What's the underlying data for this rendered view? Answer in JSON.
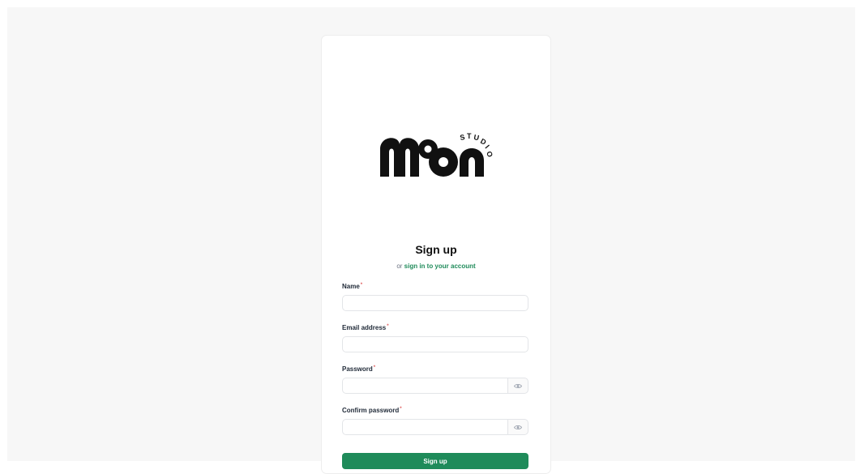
{
  "logo": {
    "icon": "moon-studio-logo",
    "wordmark": "moon",
    "tag": "STUDIO"
  },
  "signup": {
    "title": "Sign up",
    "subtitle_prefix": "or ",
    "signin_link": "sign in to your account",
    "fields": {
      "name": {
        "label": "Name",
        "value": ""
      },
      "email": {
        "label": "Email address",
        "value": ""
      },
      "password": {
        "label": "Password",
        "value": ""
      },
      "confirm": {
        "label": "Confirm password",
        "value": ""
      }
    },
    "required_mark": "*",
    "submit_label": "Sign up"
  },
  "colors": {
    "accent": "#1f8b5a",
    "required": "#e05d5d",
    "background": "#f7f7f7"
  }
}
